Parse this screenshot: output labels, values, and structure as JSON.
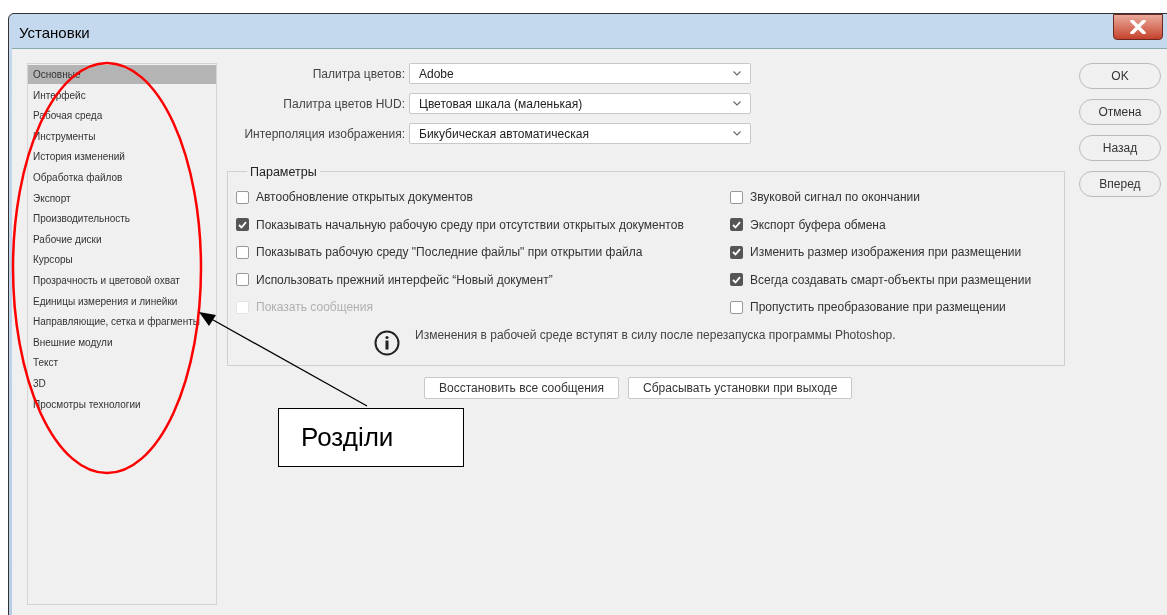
{
  "window": {
    "title": "Установки"
  },
  "sidebar": {
    "items": [
      {
        "label": "Основные",
        "selected": true
      },
      {
        "label": "Интерфейс",
        "selected": false
      },
      {
        "label": "Рабочая среда",
        "selected": false
      },
      {
        "label": "Инструменты",
        "selected": false
      },
      {
        "label": "История изменений",
        "selected": false
      },
      {
        "label": "Обработка файлов",
        "selected": false
      },
      {
        "label": "Экспорт",
        "selected": false
      },
      {
        "label": "Производительность",
        "selected": false
      },
      {
        "label": "Рабочие диски",
        "selected": false
      },
      {
        "label": "Курсоры",
        "selected": false
      },
      {
        "label": "Прозрачность и цветовой охват",
        "selected": false
      },
      {
        "label": "Единицы измерения и линейки",
        "selected": false
      },
      {
        "label": "Направляющие, сетка и фрагменты",
        "selected": false
      },
      {
        "label": "Внешние модули",
        "selected": false
      },
      {
        "label": "Текст",
        "selected": false
      },
      {
        "label": "3D",
        "selected": false
      },
      {
        "label": "Просмотры технологии",
        "selected": false
      }
    ]
  },
  "dropdowns": [
    {
      "label": "Палитра цветов:",
      "value": "Adobe"
    },
    {
      "label": "Палитра цветов HUD:",
      "value": "Цветовая шкала (маленькая)"
    },
    {
      "label": "Интерполяция изображения:",
      "value": "Бикубическая автоматическая"
    }
  ],
  "options": {
    "title": "Параметры",
    "left": [
      {
        "label": "Автообновление открытых документов",
        "checked": false,
        "disabled": false
      },
      {
        "label": "Показывать начальную рабочую среду при отсутствии открытых документов",
        "checked": true,
        "disabled": false
      },
      {
        "label": "Показывать рабочую среду \"Последние файлы\" при открытии файла",
        "checked": false,
        "disabled": false
      },
      {
        "label": "Использовать прежний интерфейс “Новый документ”",
        "checked": false,
        "disabled": false
      },
      {
        "label": "Показать сообщения",
        "checked": false,
        "disabled": true
      }
    ],
    "right": [
      {
        "label": "Звуковой сигнал по окончании",
        "checked": false,
        "disabled": false
      },
      {
        "label": "Экспорт буфера обмена",
        "checked": true,
        "disabled": false
      },
      {
        "label": "Изменить размер изображения при размещении",
        "checked": true,
        "disabled": false
      },
      {
        "label": "Всегда создавать смарт-объекты при размещении",
        "checked": true,
        "disabled": false
      },
      {
        "label": "Пропустить преобразование при размещении",
        "checked": false,
        "disabled": false
      }
    ],
    "notice": "Изменения в рабочей среде вступят в силу после перезапуска программы Photoshop."
  },
  "bottom_buttons": [
    "Восстановить все сообщения",
    "Сбрасывать установки при выходе"
  ],
  "side_buttons": [
    "OK",
    "Отмена",
    "Назад",
    "Вперед"
  ],
  "annotation": {
    "callout": "Розділи"
  }
}
